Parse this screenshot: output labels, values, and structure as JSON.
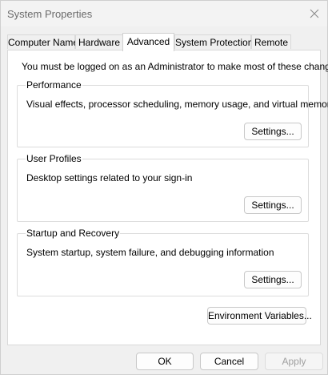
{
  "window": {
    "title": "System Properties",
    "close_icon": "close-icon"
  },
  "tabs": [
    {
      "label": "Computer Name",
      "active": false
    },
    {
      "label": "Hardware",
      "active": false
    },
    {
      "label": "Advanced",
      "active": true
    },
    {
      "label": "System Protection",
      "active": false
    },
    {
      "label": "Remote",
      "active": false
    }
  ],
  "advanced": {
    "admin_note": "You must be logged on as an Administrator to make most of these changes.",
    "groups": [
      {
        "title": "Performance",
        "description": "Visual effects, processor scheduling, memory usage, and virtual memory",
        "button": "Settings..."
      },
      {
        "title": "User Profiles",
        "description": "Desktop settings related to your sign-in",
        "button": "Settings..."
      },
      {
        "title": "Startup and Recovery",
        "description": "System startup, system failure, and debugging information",
        "button": "Settings..."
      }
    ],
    "env_button": "Environment Variables..."
  },
  "footer": {
    "ok": "OK",
    "cancel": "Cancel",
    "apply": "Apply",
    "apply_enabled": false
  }
}
